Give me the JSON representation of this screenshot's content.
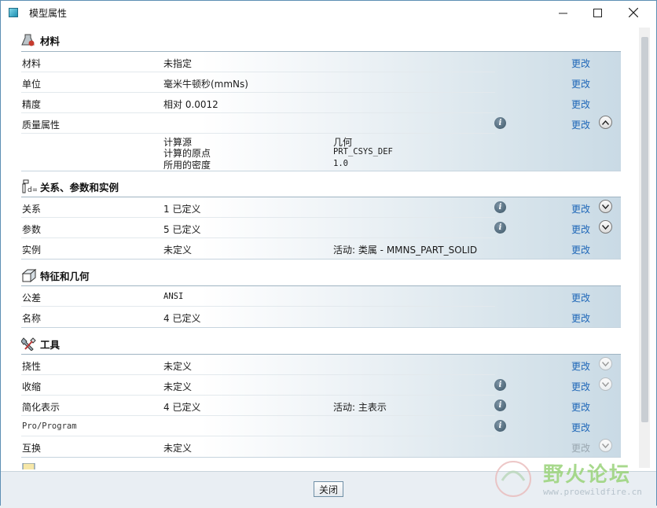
{
  "window": {
    "title": "模型属性",
    "close_button": "关闭"
  },
  "change_label": "更改",
  "sections": {
    "material": {
      "title": "材料",
      "rows": [
        {
          "label": "材料",
          "value": "未指定"
        },
        {
          "label": "单位",
          "value": "毫米牛顿秒(mmNs)"
        },
        {
          "label": "精度",
          "value": "相对 0.0012"
        },
        {
          "label": "质量属性",
          "value": ""
        }
      ],
      "mass_details": [
        {
          "label": "计算源",
          "value": "几何"
        },
        {
          "label": "计算的原点",
          "value": "PRT_CSYS_DEF"
        },
        {
          "label": "所用的密度",
          "value": "1.0"
        }
      ]
    },
    "relations": {
      "title": "关系、参数和实例",
      "rows": [
        {
          "label": "关系",
          "value": "1 已定义"
        },
        {
          "label": "参数",
          "value": "5 已定义"
        },
        {
          "label": "实例",
          "value": "未定义",
          "extra": "活动: 类属 - MMNS_PART_SOLID"
        }
      ]
    },
    "features": {
      "title": "特征和几何",
      "rows": [
        {
          "label": "公差",
          "value": "ANSI"
        },
        {
          "label": "名称",
          "value": "4 已定义"
        }
      ]
    },
    "tools": {
      "title": "工具",
      "rows": [
        {
          "label": "挠性",
          "value": "未定义"
        },
        {
          "label": "收缩",
          "value": "未定义"
        },
        {
          "label": "简化表示",
          "value": "4 已定义",
          "extra": "活动: 主表示"
        },
        {
          "label": "Pro/Program",
          "value": ""
        },
        {
          "label": "互换",
          "value": "未定义"
        }
      ]
    }
  },
  "watermark": {
    "text": "野火论坛",
    "url": "www.proewildfire.cn"
  },
  "colors": {
    "link": "#1f67b8",
    "border": "#5d8fb4",
    "header_bg": "#c9dae5"
  }
}
